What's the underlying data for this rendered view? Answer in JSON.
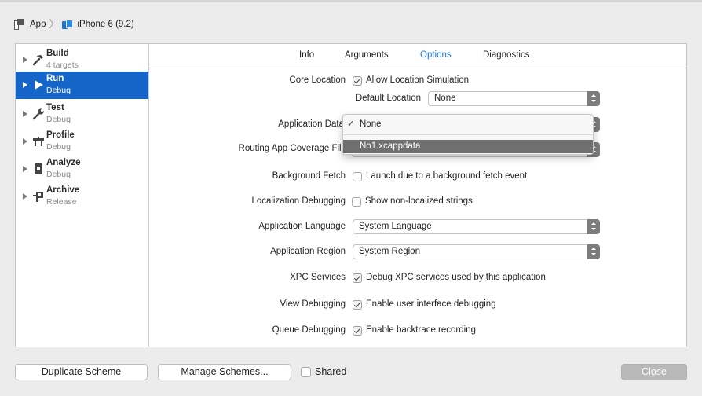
{
  "breadcrumb": {
    "app": "App",
    "separator": "〉",
    "device": "iPhone 6 (9.2)"
  },
  "sidebar": {
    "items": [
      {
        "name": "Build",
        "sub": "4 targets",
        "icon": "hammer-icon",
        "selected": false
      },
      {
        "name": "Run",
        "sub": "Debug",
        "icon": "play-icon",
        "selected": true
      },
      {
        "name": "Test",
        "sub": "Debug",
        "icon": "wrench-icon",
        "selected": false
      },
      {
        "name": "Profile",
        "sub": "Debug",
        "icon": "instruments-icon",
        "selected": false
      },
      {
        "name": "Analyze",
        "sub": "Debug",
        "icon": "analyze-icon",
        "selected": false
      },
      {
        "name": "Archive",
        "sub": "Release",
        "icon": "archive-icon",
        "selected": false
      }
    ]
  },
  "tabs": [
    {
      "label": "Info",
      "active": false
    },
    {
      "label": "Arguments",
      "active": false
    },
    {
      "label": "Options",
      "active": true
    },
    {
      "label": "Diagnostics",
      "active": false
    }
  ],
  "options": {
    "core_location": {
      "label": "Core Location",
      "checkbox_label": "Allow Location Simulation",
      "checked": true
    },
    "default_location": {
      "label": "Default Location",
      "value": "None"
    },
    "application_data": {
      "label": "Application Data"
    },
    "routing": {
      "label": "Routing App Coverage File"
    },
    "background_fetch": {
      "label": "Background Fetch",
      "checkbox_label": "Launch due to a background fetch event",
      "checked": false
    },
    "localization": {
      "label": "Localization Debugging",
      "checkbox_label": "Show non-localized strings",
      "checked": false
    },
    "app_language": {
      "label": "Application Language",
      "value": "System Language"
    },
    "app_region": {
      "label": "Application Region",
      "value": "System Region"
    },
    "xpc": {
      "label": "XPC Services",
      "checkbox_label": "Debug XPC services used by this application",
      "checked": true
    },
    "view_debugging": {
      "label": "View Debugging",
      "checkbox_label": "Enable user interface debugging",
      "checked": true
    },
    "queue_debugging": {
      "label": "Queue Debugging",
      "checkbox_label": "Enable backtrace recording",
      "checked": true
    }
  },
  "popup": {
    "options": [
      {
        "label": "None",
        "checked": true,
        "check_mark": "✓"
      },
      {
        "label": "No1.xcappdata",
        "checked": false,
        "highlighted": true
      }
    ]
  },
  "footer": {
    "duplicate_label": "Duplicate Scheme",
    "manage_label": "Manage Schemes...",
    "shared_label": "Shared",
    "shared_checked": false,
    "close_label": "Close"
  },
  "colors": {
    "selection": "#1565c9",
    "active_tab": "#1b74d6",
    "menu_highlight": "#6f6f6f"
  }
}
